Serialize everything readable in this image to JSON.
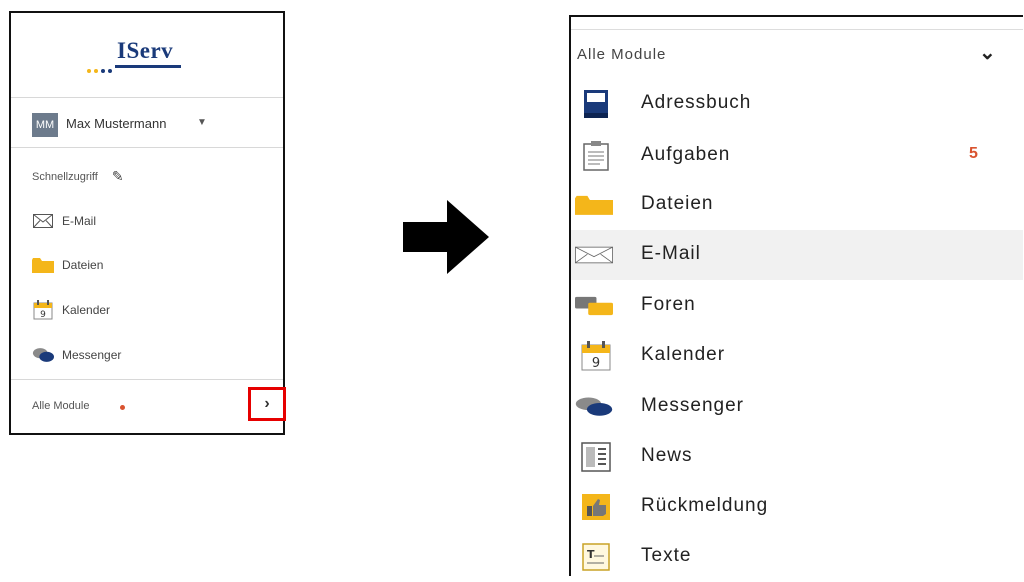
{
  "left_panel": {
    "logo_text": "IServ",
    "user": {
      "initials": "MM",
      "name": "Max Mustermann"
    },
    "shortcut_label": "Schnellzugriff",
    "items": [
      {
        "label": "E-Mail",
        "icon": "envelope-icon"
      },
      {
        "label": "Dateien",
        "icon": "folder-icon"
      },
      {
        "label": "Kalender",
        "icon": "calendar-icon"
      },
      {
        "label": "Messenger",
        "icon": "chat-bubbles-icon"
      }
    ],
    "all_modules_label": "Alle Module",
    "expand_icon": "chevron-right-icon"
  },
  "right_panel": {
    "header_label": "Alle Module",
    "collapse_icon": "chevron-down-icon",
    "items": [
      {
        "label": "Adressbuch",
        "icon": "address-book-icon",
        "badge": ""
      },
      {
        "label": "Aufgaben",
        "icon": "clipboard-icon",
        "badge": "5"
      },
      {
        "label": "Dateien",
        "icon": "folder-icon",
        "badge": ""
      },
      {
        "label": "E-Mail",
        "icon": "envelope-icon",
        "badge": "",
        "active": true
      },
      {
        "label": "Foren",
        "icon": "forum-icon",
        "badge": ""
      },
      {
        "label": "Kalender",
        "icon": "calendar-icon",
        "badge": ""
      },
      {
        "label": "Messenger",
        "icon": "chat-bubbles-icon",
        "badge": ""
      },
      {
        "label": "News",
        "icon": "newspaper-icon",
        "badge": ""
      },
      {
        "label": "Rückmeldung",
        "icon": "feedback-icon",
        "badge": ""
      },
      {
        "label": "Texte",
        "icon": "text-document-icon",
        "badge": ""
      }
    ]
  },
  "colors": {
    "brand_navy": "#1a3a7a",
    "folder_yellow": "#f4b61a",
    "badge_orange": "#d9532f",
    "highlight_red": "#e60000"
  }
}
